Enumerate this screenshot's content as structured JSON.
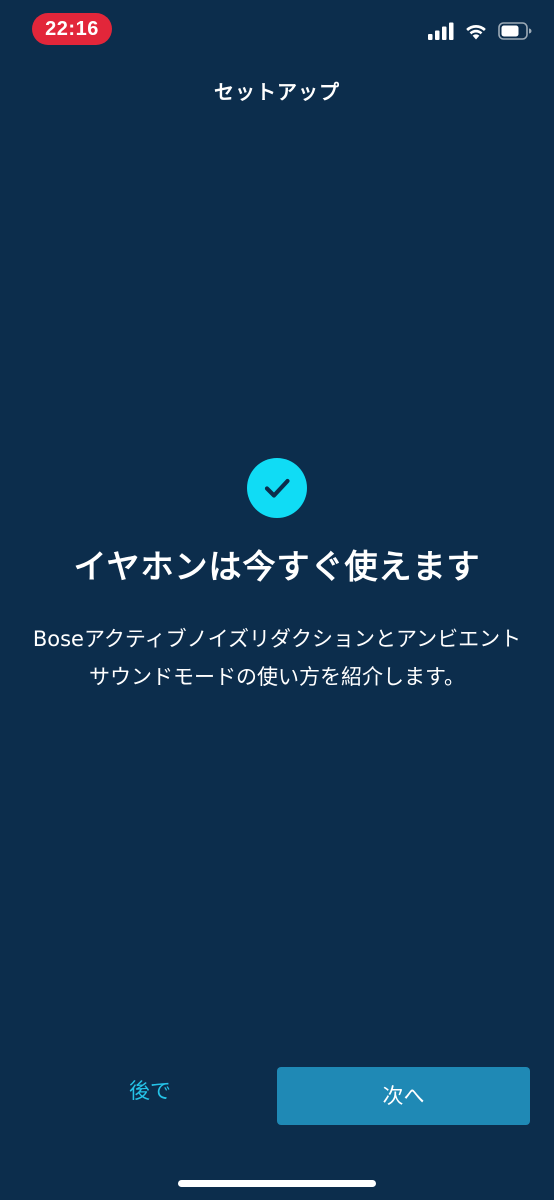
{
  "status_bar": {
    "time": "22:16",
    "icons": [
      "cellular-signal-icon",
      "wifi-icon",
      "battery-icon"
    ],
    "time_pill_color": "#e2263a"
  },
  "header": {
    "title": "セットアップ"
  },
  "main": {
    "success_icon": "checkmark-circle-icon",
    "heading": "イヤホンは今すぐ使えます",
    "description": "Boseアクティブノイズリダクションとアンビエントサウンドモードの使い方を紹介します。"
  },
  "actions": {
    "later_label": "後で",
    "next_label": "次へ"
  },
  "colors": {
    "background": "#0c2d4c",
    "accent_cyan": "#10dcf5",
    "link_cyan": "#25c3e8",
    "primary_button": "#1f89b5"
  }
}
